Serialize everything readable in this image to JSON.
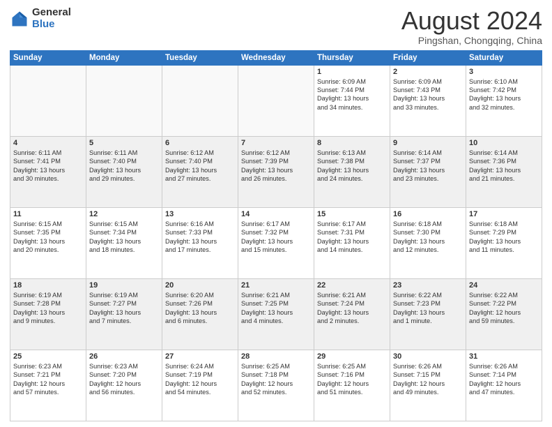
{
  "logo": {
    "general": "General",
    "blue": "Blue"
  },
  "title": "August 2024",
  "location": "Pingshan, Chongqing, China",
  "days_of_week": [
    "Sunday",
    "Monday",
    "Tuesday",
    "Wednesday",
    "Thursday",
    "Friday",
    "Saturday"
  ],
  "weeks": [
    [
      {
        "day": "",
        "detail": "",
        "empty": true
      },
      {
        "day": "",
        "detail": "",
        "empty": true
      },
      {
        "day": "",
        "detail": "",
        "empty": true
      },
      {
        "day": "",
        "detail": "",
        "empty": true
      },
      {
        "day": "1",
        "detail": "Sunrise: 6:09 AM\nSunset: 7:44 PM\nDaylight: 13 hours\nand 34 minutes.",
        "empty": false
      },
      {
        "day": "2",
        "detail": "Sunrise: 6:09 AM\nSunset: 7:43 PM\nDaylight: 13 hours\nand 33 minutes.",
        "empty": false
      },
      {
        "day": "3",
        "detail": "Sunrise: 6:10 AM\nSunset: 7:42 PM\nDaylight: 13 hours\nand 32 minutes.",
        "empty": false
      }
    ],
    [
      {
        "day": "4",
        "detail": "Sunrise: 6:11 AM\nSunset: 7:41 PM\nDaylight: 13 hours\nand 30 minutes.",
        "empty": false
      },
      {
        "day": "5",
        "detail": "Sunrise: 6:11 AM\nSunset: 7:40 PM\nDaylight: 13 hours\nand 29 minutes.",
        "empty": false
      },
      {
        "day": "6",
        "detail": "Sunrise: 6:12 AM\nSunset: 7:40 PM\nDaylight: 13 hours\nand 27 minutes.",
        "empty": false
      },
      {
        "day": "7",
        "detail": "Sunrise: 6:12 AM\nSunset: 7:39 PM\nDaylight: 13 hours\nand 26 minutes.",
        "empty": false
      },
      {
        "day": "8",
        "detail": "Sunrise: 6:13 AM\nSunset: 7:38 PM\nDaylight: 13 hours\nand 24 minutes.",
        "empty": false
      },
      {
        "day": "9",
        "detail": "Sunrise: 6:14 AM\nSunset: 7:37 PM\nDaylight: 13 hours\nand 23 minutes.",
        "empty": false
      },
      {
        "day": "10",
        "detail": "Sunrise: 6:14 AM\nSunset: 7:36 PM\nDaylight: 13 hours\nand 21 minutes.",
        "empty": false
      }
    ],
    [
      {
        "day": "11",
        "detail": "Sunrise: 6:15 AM\nSunset: 7:35 PM\nDaylight: 13 hours\nand 20 minutes.",
        "empty": false
      },
      {
        "day": "12",
        "detail": "Sunrise: 6:15 AM\nSunset: 7:34 PM\nDaylight: 13 hours\nand 18 minutes.",
        "empty": false
      },
      {
        "day": "13",
        "detail": "Sunrise: 6:16 AM\nSunset: 7:33 PM\nDaylight: 13 hours\nand 17 minutes.",
        "empty": false
      },
      {
        "day": "14",
        "detail": "Sunrise: 6:17 AM\nSunset: 7:32 PM\nDaylight: 13 hours\nand 15 minutes.",
        "empty": false
      },
      {
        "day": "15",
        "detail": "Sunrise: 6:17 AM\nSunset: 7:31 PM\nDaylight: 13 hours\nand 14 minutes.",
        "empty": false
      },
      {
        "day": "16",
        "detail": "Sunrise: 6:18 AM\nSunset: 7:30 PM\nDaylight: 13 hours\nand 12 minutes.",
        "empty": false
      },
      {
        "day": "17",
        "detail": "Sunrise: 6:18 AM\nSunset: 7:29 PM\nDaylight: 13 hours\nand 11 minutes.",
        "empty": false
      }
    ],
    [
      {
        "day": "18",
        "detail": "Sunrise: 6:19 AM\nSunset: 7:28 PM\nDaylight: 13 hours\nand 9 minutes.",
        "empty": false
      },
      {
        "day": "19",
        "detail": "Sunrise: 6:19 AM\nSunset: 7:27 PM\nDaylight: 13 hours\nand 7 minutes.",
        "empty": false
      },
      {
        "day": "20",
        "detail": "Sunrise: 6:20 AM\nSunset: 7:26 PM\nDaylight: 13 hours\nand 6 minutes.",
        "empty": false
      },
      {
        "day": "21",
        "detail": "Sunrise: 6:21 AM\nSunset: 7:25 PM\nDaylight: 13 hours\nand 4 minutes.",
        "empty": false
      },
      {
        "day": "22",
        "detail": "Sunrise: 6:21 AM\nSunset: 7:24 PM\nDaylight: 13 hours\nand 2 minutes.",
        "empty": false
      },
      {
        "day": "23",
        "detail": "Sunrise: 6:22 AM\nSunset: 7:23 PM\nDaylight: 13 hours\nand 1 minute.",
        "empty": false
      },
      {
        "day": "24",
        "detail": "Sunrise: 6:22 AM\nSunset: 7:22 PM\nDaylight: 12 hours\nand 59 minutes.",
        "empty": false
      }
    ],
    [
      {
        "day": "25",
        "detail": "Sunrise: 6:23 AM\nSunset: 7:21 PM\nDaylight: 12 hours\nand 57 minutes.",
        "empty": false
      },
      {
        "day": "26",
        "detail": "Sunrise: 6:23 AM\nSunset: 7:20 PM\nDaylight: 12 hours\nand 56 minutes.",
        "empty": false
      },
      {
        "day": "27",
        "detail": "Sunrise: 6:24 AM\nSunset: 7:19 PM\nDaylight: 12 hours\nand 54 minutes.",
        "empty": false
      },
      {
        "day": "28",
        "detail": "Sunrise: 6:25 AM\nSunset: 7:18 PM\nDaylight: 12 hours\nand 52 minutes.",
        "empty": false
      },
      {
        "day": "29",
        "detail": "Sunrise: 6:25 AM\nSunset: 7:16 PM\nDaylight: 12 hours\nand 51 minutes.",
        "empty": false
      },
      {
        "day": "30",
        "detail": "Sunrise: 6:26 AM\nSunset: 7:15 PM\nDaylight: 12 hours\nand 49 minutes.",
        "empty": false
      },
      {
        "day": "31",
        "detail": "Sunrise: 6:26 AM\nSunset: 7:14 PM\nDaylight: 12 hours\nand 47 minutes.",
        "empty": false
      }
    ]
  ]
}
